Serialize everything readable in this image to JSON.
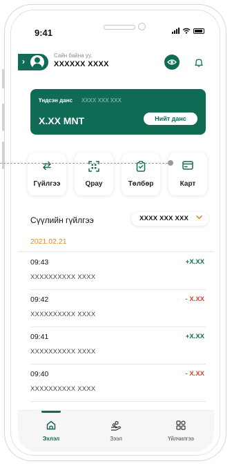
{
  "status_bar": {
    "time": "9:41"
  },
  "header": {
    "greeting": "Сайн байна уу,",
    "username": "XXXXXX XXXX"
  },
  "account_card": {
    "label": "Үндсэн данс",
    "number": "XXXX XXX XXX",
    "balance": "X.XX MNT",
    "all_accounts_button": "Нийт данс"
  },
  "actions": [
    {
      "label": "Гүйлгээ",
      "icon": "transfer-icon"
    },
    {
      "label": "Qpay",
      "icon": "qr-scan-icon"
    },
    {
      "label": "Төлбөр",
      "icon": "payment-icon"
    },
    {
      "label": "Карт",
      "icon": "card-icon"
    }
  ],
  "recent": {
    "title": "Сүүлийн гүйлгээ",
    "account_selector": "XXXX XXX XXX",
    "date": "2021.02.21"
  },
  "transactions": [
    {
      "time": "09:43",
      "description": "XXXXXXXXXX XXXX",
      "amount": "+X.XX",
      "type": "credit"
    },
    {
      "time": "09:42",
      "description": "XXXXXXXXXX XXXX",
      "amount": "- X.XX",
      "type": "debit"
    },
    {
      "time": "09:41",
      "description": "XXXXXXXXXX XXXX",
      "amount": "+X.XX",
      "type": "credit"
    },
    {
      "time": "09:40",
      "description": "XXXXXXXXXX XXXX",
      "amount": "- X.XX",
      "type": "debit"
    }
  ],
  "bottom_nav": [
    {
      "label": "Эхлэл",
      "icon": "home-icon",
      "active": true
    },
    {
      "label": "Зээл",
      "icon": "loan-icon",
      "active": false
    },
    {
      "label": "Үйлчилгээ",
      "icon": "services-icon",
      "active": false
    }
  ],
  "colors": {
    "primary": "#0f6b53",
    "credit": "#0f6b53",
    "debit": "#e0402a",
    "date": "#e08a2a"
  }
}
